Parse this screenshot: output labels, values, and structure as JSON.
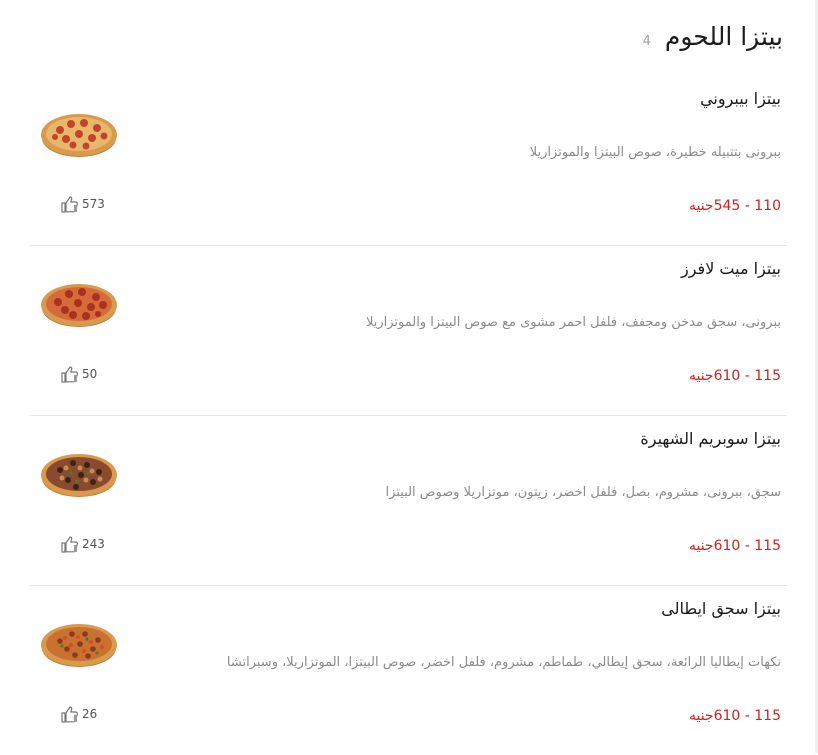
{
  "section": {
    "title": "بيتزا اللحوم",
    "count": "4"
  },
  "items": [
    {
      "name": "بيتزا بيبروني",
      "description": "ببرونى بتتبيله خطيرة، صوص البيتزا والموتزاريلا",
      "price": "110 - 545جنيه",
      "likes": "573",
      "image_icon": "pepperoni-pizza"
    },
    {
      "name": "بيتزا ميت لافرز",
      "description": "ببرونى، سجق مدخن ومجفف، فلفل احمر مشوى مع صوص البيتزا والموتزاريلا",
      "price": "115 - 610جنيه",
      "likes": "50",
      "image_icon": "meat-lovers-pizza"
    },
    {
      "name": "بيتزا سوبريم الشهيرة",
      "description": "سجق، ببرونى، مشروم، بصل، فلفل اخضر، زيتون، موتزاريلا وصوص البيتزا",
      "price": "115 - 610جنيه",
      "likes": "243",
      "image_icon": "supreme-pizza"
    },
    {
      "name": "بيتزا سجق ايطالى",
      "description": "نكهات إيطاليا الرائعة، سجق إيطالي، طماطم، مشروم، فلفل اخضر، صوص البيتزا، الموتزاريلا، وسبراتشا",
      "price": "115 - 610جنيه",
      "likes": "26",
      "image_icon": "italian-sausage-pizza"
    }
  ],
  "colors": {
    "price": "#d0221f",
    "description": "#8a8a8a",
    "divider": "#e6e6e6"
  }
}
